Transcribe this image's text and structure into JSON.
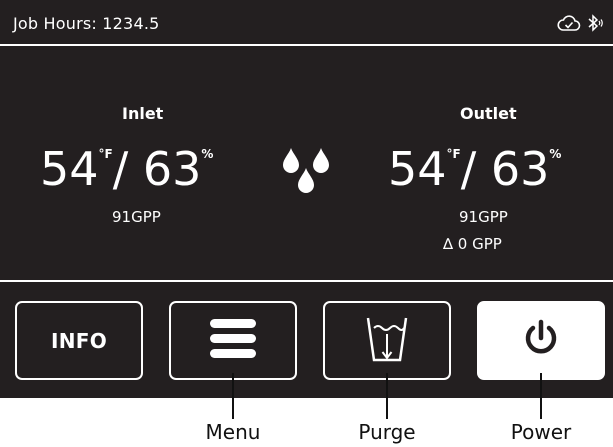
{
  "status_bar": {
    "job_hours": "Job Hours: 1234.5",
    "icons": [
      "cloud-check-icon",
      "bluetooth-icon"
    ]
  },
  "inlet": {
    "label": "Inlet",
    "temp": "54",
    "temp_unit": "°F",
    "separator": "/",
    "humidity": "63",
    "humidity_unit": "%",
    "gpp": "91GPP"
  },
  "outlet": {
    "label": "Outlet",
    "temp": "54",
    "temp_unit": "°F",
    "separator": "/",
    "humidity": "63",
    "humidity_unit": "%",
    "gpp": "91GPP",
    "delta": "∆ 0 GPP"
  },
  "buttons": {
    "info": "INFO",
    "menu_icon": "menu-icon",
    "purge_icon": "purge-icon",
    "power_icon": "power-icon"
  },
  "callouts": {
    "menu": "Menu",
    "purge": "Purge",
    "power": "Power"
  },
  "colors": {
    "screen_bg": "#231f20",
    "foreground": "#ffffff",
    "callout_text": "#111111"
  }
}
